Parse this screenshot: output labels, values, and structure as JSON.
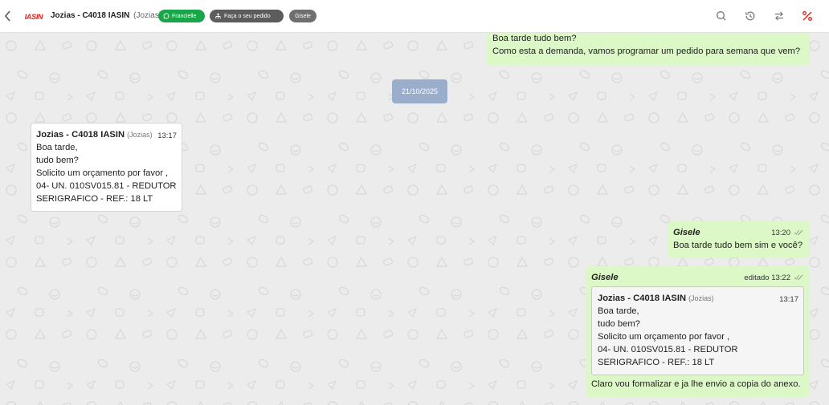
{
  "header": {
    "logo_text": "IASIN",
    "contact_name": "Jozias - C4018 IASIN",
    "contact_sub": "(Jozias)",
    "tags": [
      {
        "label": "Francielle",
        "icon": "whatsapp-icon",
        "color": "#19a64a"
      },
      {
        "label": "Faça o seu pedido",
        "icon": "sitemap-icon",
        "color": "#5c5c5c"
      },
      {
        "label": "Gisele",
        "icon": "",
        "color": "#6f6f6f"
      }
    ],
    "actions": [
      "search-icon",
      "history-icon",
      "transfer-icon",
      "percent-icon"
    ],
    "accent_color": "#e0261c"
  },
  "messages": {
    "m1": {
      "lines": [
        "Boa tarde tudo bem?",
        "Como esta a demanda, vamos programar um pedido para semana que vem?"
      ]
    },
    "date_chip": "21/10/2025",
    "m2": {
      "sender": "Jozias - C4018 IASIN",
      "sender_org": "(Jozias)",
      "time": "13:17",
      "lines": [
        "Boa tarde,",
        "tudo bem?",
        "Solicito um orçamento por favor ,",
        "04- UN. 010SV015.81 - REDUTOR",
        "SERIGRAFICO - REF.: 18 LT"
      ]
    },
    "m3": {
      "sender": "Gisele",
      "time": "13:20",
      "lines": [
        "Boa tarde tudo bem sim e você?"
      ]
    },
    "m4": {
      "sender": "Gisele",
      "time": "editado 13:22",
      "quoted": {
        "sender": "Jozias - C4018 IASIN",
        "sender_org": "(Jozias)",
        "time": "13:17",
        "lines": [
          "Boa tarde,",
          "tudo bem?",
          "Solicito um orçamento por favor ,",
          "04- UN. 010SV015.81 - REDUTOR",
          "SERIGRAFICO - REF.: 18 LT"
        ]
      },
      "text": "Claro vou formalizar e ja lhe envio a copia do anexo."
    }
  }
}
